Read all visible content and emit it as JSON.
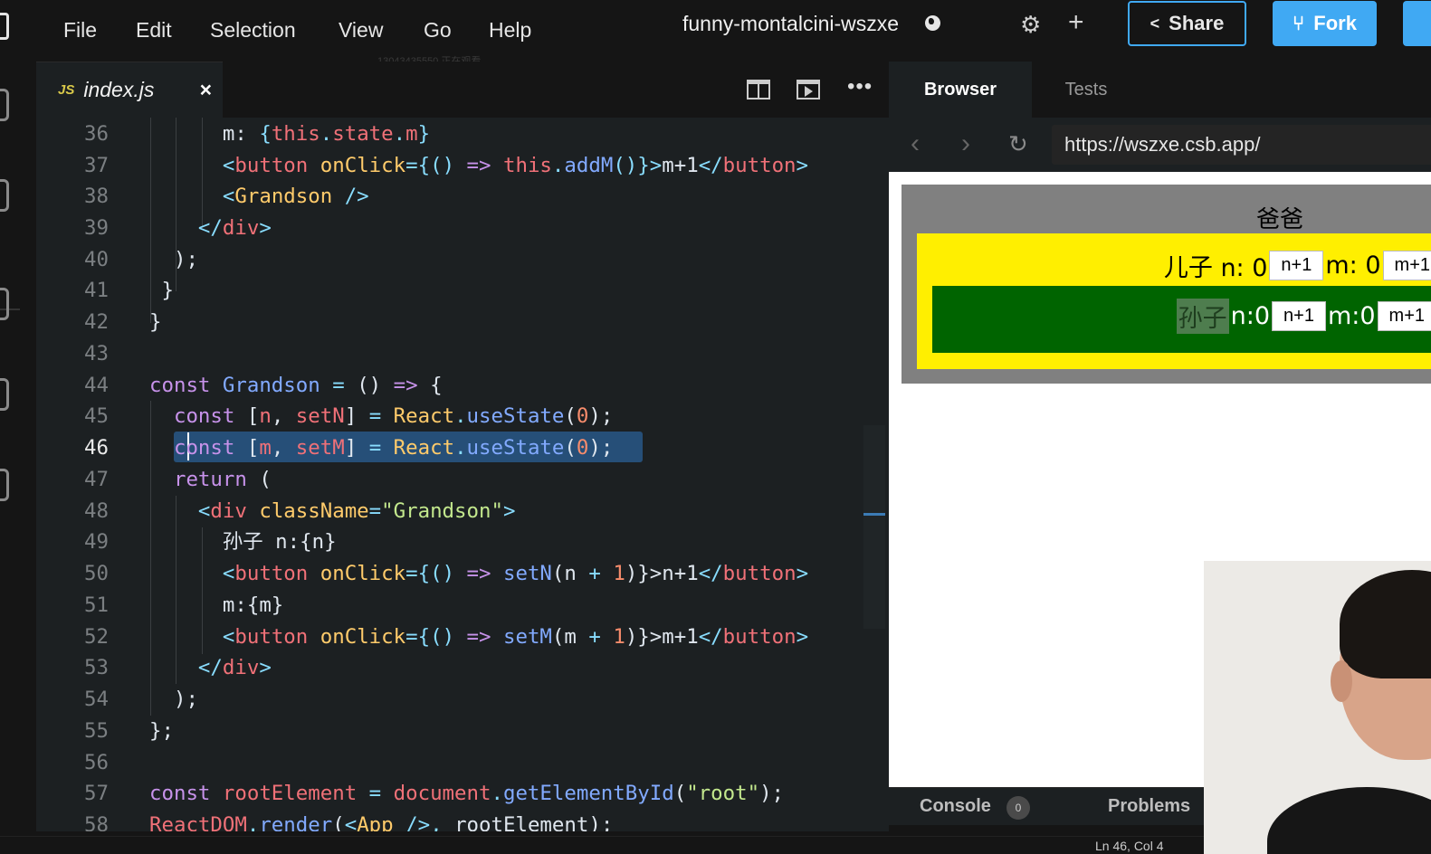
{
  "menu": {
    "items": [
      "File",
      "Edit",
      "Selection",
      "View",
      "Go",
      "Help"
    ],
    "sandbox_title": "funny-montalcini-wszxe",
    "watermark": "13043435550 正在观看",
    "share_label": "Share",
    "fork_label": "Fork"
  },
  "editor": {
    "tab_badge": "JS",
    "tab_name": "index.js",
    "active_line": 46
  },
  "browser": {
    "tabs": [
      "Browser",
      "Tests"
    ],
    "url": "https://wszxe.csb.app/",
    "dad_label": "爸爸",
    "son": {
      "label": "儿子 n: 0",
      "n_button": "n+1",
      "m_label": "m: 0",
      "m_button": "m+1"
    },
    "grandson": {
      "label": "孙子",
      "n_label": "n:0",
      "n_button": "n+1",
      "m_label": "m:0",
      "m_button": "m+1"
    },
    "console_label": "Console",
    "console_count": "0",
    "problems_label": "Problems"
  },
  "status": {
    "text": "Ln 46, Col 4"
  },
  "colors": {
    "accent": "#40a9f3",
    "dad_bg": "#808080",
    "son_bg": "#ffef00",
    "grandson_bg": "#006400",
    "selection": "#264f78"
  }
}
